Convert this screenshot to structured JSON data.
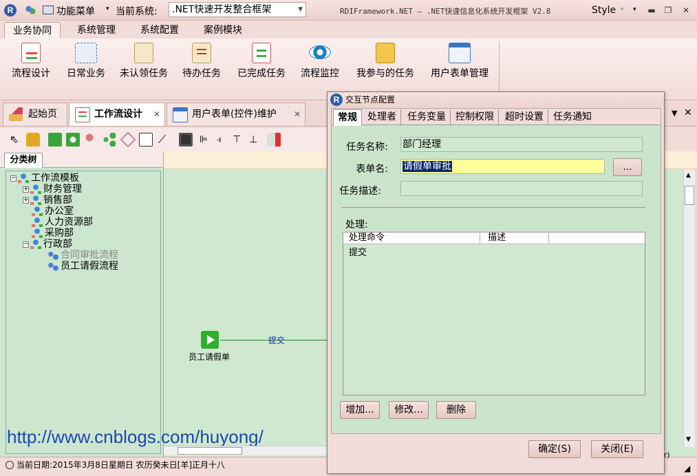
{
  "titlebar": {
    "function_menu": "功能菜单",
    "current_system_label": "当前系统:",
    "current_system_value": ".NET快速开发整合框架",
    "app_title": "RDIFramework.NET — .NET快速信息化系统开发框架 V2.8",
    "style_label": "Style"
  },
  "ribbon_tabs": [
    "业务协同",
    "系统管理",
    "系统配置",
    "案例模块"
  ],
  "ribbon_buttons": [
    "流程设计",
    "日常业务",
    "未认领任务",
    "待办任务",
    "已完成任务",
    "流程监控",
    "我参与的任务",
    "用户表单管理"
  ],
  "doc_tabs": {
    "home": "起始页",
    "workflow_design": "工作流设计",
    "user_form": "用户表单(控件)维护"
  },
  "left_panel": {
    "tab": "分类树",
    "tree": {
      "root": "工作流模板",
      "nodes": [
        "财务管理",
        "销售部",
        "办公室",
        "人力资源部",
        "采购部",
        "行政部"
      ],
      "children": [
        "合同审批流程",
        "员工请假流程"
      ]
    }
  },
  "canvas": {
    "node_label": "员工请假单",
    "edge_label": "提交",
    "url": "http://www.cnblogs.com/huyong/"
  },
  "statusbar": {
    "date_text": "当前日期:2015年3月8日星期日  农历癸未日[羊]正月十八",
    "right_text": "or)"
  },
  "dialog": {
    "title": "交互节点配置",
    "tabs": [
      "常规",
      "处理者",
      "任务变量",
      "控制权限",
      "超时设置",
      "任务通知"
    ],
    "task_name_label": "任务名称:",
    "task_name_value": "部门经理",
    "form_name_label": "表单名:",
    "form_name_value": "请假单审批",
    "browse_button": "...",
    "task_desc_label": "任务描述:",
    "task_desc_value": "",
    "process_label": "处理:",
    "grid_headers": [
      "处理命令",
      "描述"
    ],
    "grid_rows": [
      {
        "command": "提交",
        "desc": ""
      }
    ],
    "add_button": "增加...",
    "edit_button": "修改...",
    "delete_button": "删除",
    "ok_button": "确定(S)",
    "close_button": "关闭(E)"
  }
}
